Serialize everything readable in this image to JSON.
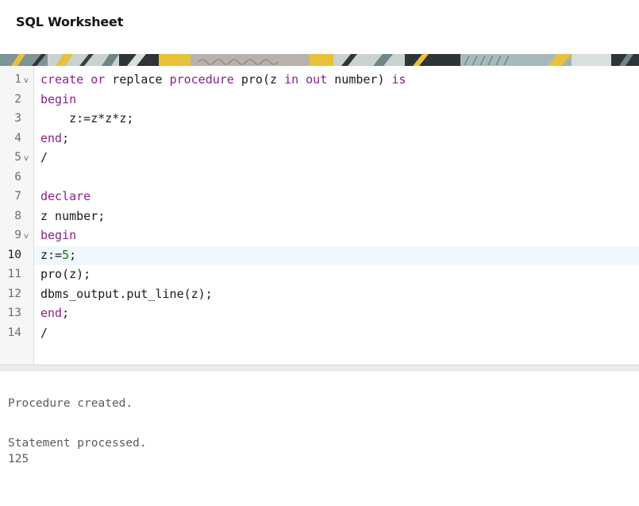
{
  "header": {
    "title": "SQL Worksheet"
  },
  "editor": {
    "active_line": "10",
    "line_numbers": [
      "1",
      "2",
      "3",
      "4",
      "5",
      "6",
      "7",
      "8",
      "9",
      "10",
      "11",
      "12",
      "13",
      "14"
    ],
    "fold_marker": "v",
    "lines": {
      "l1": {
        "kw1": "create",
        "t1": " ",
        "kw2": "or",
        "t2": " replace ",
        "kw3": "procedure",
        "t3": " pro(z ",
        "kw4": "in",
        "t4": " ",
        "kw5": "out",
        "t5": " number) ",
        "kw6": "is"
      },
      "l2": {
        "kw1": "begin"
      },
      "l3": {
        "t1": "    z:=z*z*z;"
      },
      "l4": {
        "kw1": "end",
        "t1": ";"
      },
      "l5": {
        "t1": "/"
      },
      "l7": {
        "kw1": "declare"
      },
      "l8": {
        "t1": "z number;"
      },
      "l9": {
        "kw1": "begin"
      },
      "l10": {
        "t1": "z:=",
        "n1": "5",
        "t2": ";"
      },
      "l11": {
        "t1": "pro(z);"
      },
      "l12": {
        "t1": "dbms_output.put_line(z);"
      },
      "l13": {
        "kw1": "end",
        "t1": ";"
      },
      "l14": {
        "t1": "/"
      }
    }
  },
  "output": {
    "line1": "Procedure created.",
    "line2": "Statement processed.",
    "line3": "125"
  },
  "colors": {
    "keyword": "#8b1f8b",
    "number": "#1a6b1a",
    "active_line_bg": "#f0f8fe",
    "gutter_bg": "#f6f6f6"
  }
}
